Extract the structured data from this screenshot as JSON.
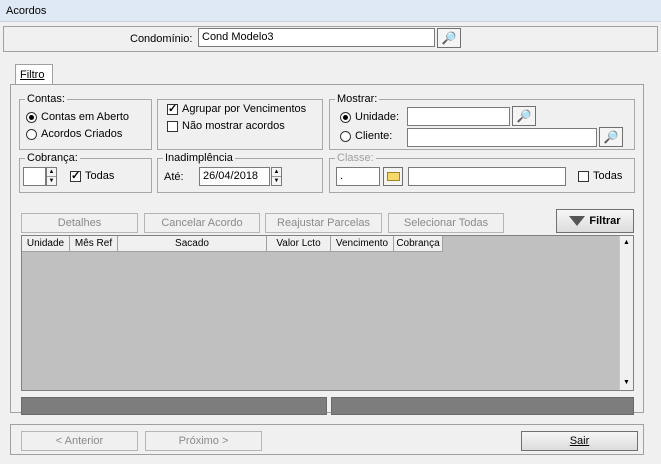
{
  "window": {
    "title": "Acordos"
  },
  "header": {
    "condominio_label": "Condomínio:",
    "condominio_value": "Cond Modelo3"
  },
  "tabs": [
    {
      "label": "Filtro"
    }
  ],
  "contas": {
    "title": "Contas:",
    "options": [
      {
        "label": "Contas em Aberto",
        "selected": true
      },
      {
        "label": "Acordos Criados",
        "selected": false
      }
    ]
  },
  "agrupar": {
    "options": [
      {
        "label": "Agrupar por Vencimentos",
        "checked": true
      },
      {
        "label": "Não mostrar acordos",
        "checked": false
      }
    ]
  },
  "mostrar": {
    "title": "Mostrar:",
    "unidade_label": "Unidade:",
    "cliente_label": "Cliente:",
    "unidade_value": "",
    "cliente_value": ""
  },
  "cobranca": {
    "title": "Cobrança:",
    "value": "",
    "todas_label": "Todas",
    "todas_checked": true
  },
  "inadimplencia": {
    "title": "Inadimplência",
    "ate_label": "Até:",
    "date_value": "26/04/2018"
  },
  "classe": {
    "title": "Classe:",
    "code_value": ".",
    "desc_value": "",
    "todas_label": "Todas",
    "todas_checked": false
  },
  "actions": {
    "detalhes": "Detalhes",
    "cancelar": "Cancelar Acordo",
    "reajustar": "Reajustar Parcelas",
    "selecionar": "Selecionar Todas",
    "filtrar": "Filtrar"
  },
  "grid": {
    "columns": [
      "Unidade",
      "Mês Ref",
      "Sacado",
      "Valor Lcto",
      "Vencimento",
      "Cobrança"
    ]
  },
  "footer": {
    "anterior": "<  Anterior",
    "proximo": "Próximo  >",
    "sair": "Sair"
  },
  "colors": {
    "grid_bg": "#c0c0c0",
    "status_bar": "#7d7d7d",
    "titlebar": "#dfe9f5"
  }
}
